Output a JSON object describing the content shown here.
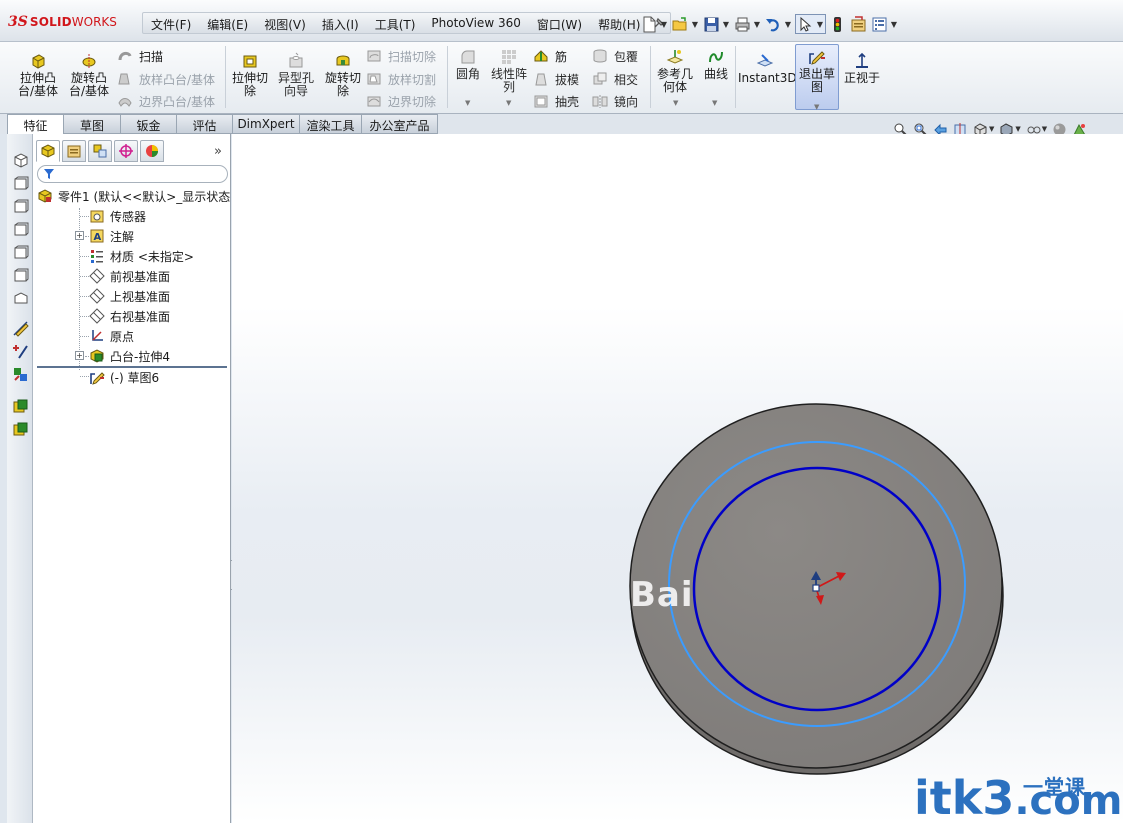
{
  "app": {
    "logo_prefix": "3S",
    "logo_solid": "SOLID",
    "logo_works": "WORKS"
  },
  "menus": [
    "文件(F)",
    "编辑(E)",
    "视图(V)",
    "插入(I)",
    "工具(T)",
    "PhotoView 360",
    "窗口(W)",
    "帮助(H)"
  ],
  "toolbar": {
    "extrude_boss": "拉伸凸台/基体",
    "revolve_boss": "旋转凸台/基体",
    "sweep": "扫描",
    "loft_boss": "放样凸台/基体",
    "boundary_boss": "边界凸台/基体",
    "extrude_cut": "拉伸切除",
    "hole_wizard": "异型孔向导",
    "revolve_cut": "旋转切除",
    "swept_cut": "扫描切除",
    "lofted_cut": "放样切割",
    "boundary_cut": "边界切除",
    "fillet": "圆角",
    "linear_pattern": "线性阵列",
    "rib": "筋",
    "draft": "拔模",
    "shell": "抽壳",
    "wrap": "包覆",
    "intersect": "相交",
    "mirror": "镜向",
    "ref_geometry": "参考几何体",
    "curves": "曲线",
    "instant3d": "Instant3D",
    "exit_sketch": "退出草图",
    "normal_to": "正视于"
  },
  "tabs": [
    {
      "label": "特征",
      "active": true
    },
    {
      "label": "草图"
    },
    {
      "label": "钣金"
    },
    {
      "label": "评估"
    },
    {
      "label": "DimXpert"
    },
    {
      "label": "渲染工具"
    },
    {
      "label": "办公室产品"
    }
  ],
  "feature_tree": {
    "more_glyph": "»",
    "items": [
      {
        "label": "零件1  (默认<<默认>_显示状态",
        "icon": "part-icon"
      },
      {
        "label": "传感器",
        "icon": "sensor-icon"
      },
      {
        "label": "注解",
        "icon": "annotation-icon"
      },
      {
        "label": "材质 <未指定>",
        "icon": "material-icon"
      },
      {
        "label": "前视基准面",
        "icon": "plane-icon"
      },
      {
        "label": "上视基准面",
        "icon": "plane-icon"
      },
      {
        "label": "右视基准面",
        "icon": "plane-icon"
      },
      {
        "label": "原点",
        "icon": "origin-icon"
      },
      {
        "label": "凸台-拉伸4",
        "icon": "extrude-feature-icon"
      },
      {
        "label": "(-) 草图6",
        "icon": "sketch-icon"
      }
    ]
  },
  "watermarks": {
    "baidu": "Bai",
    "site": "itk3",
    "site_cn": "一堂课",
    "site_tld": ".com"
  },
  "colors": {
    "part_fill": "#858280",
    "part_edge": "#1f1f1f",
    "sketch_circle": "#0000c8",
    "edge_circle": "#3b9cff",
    "accent_red": "#d1161b"
  }
}
